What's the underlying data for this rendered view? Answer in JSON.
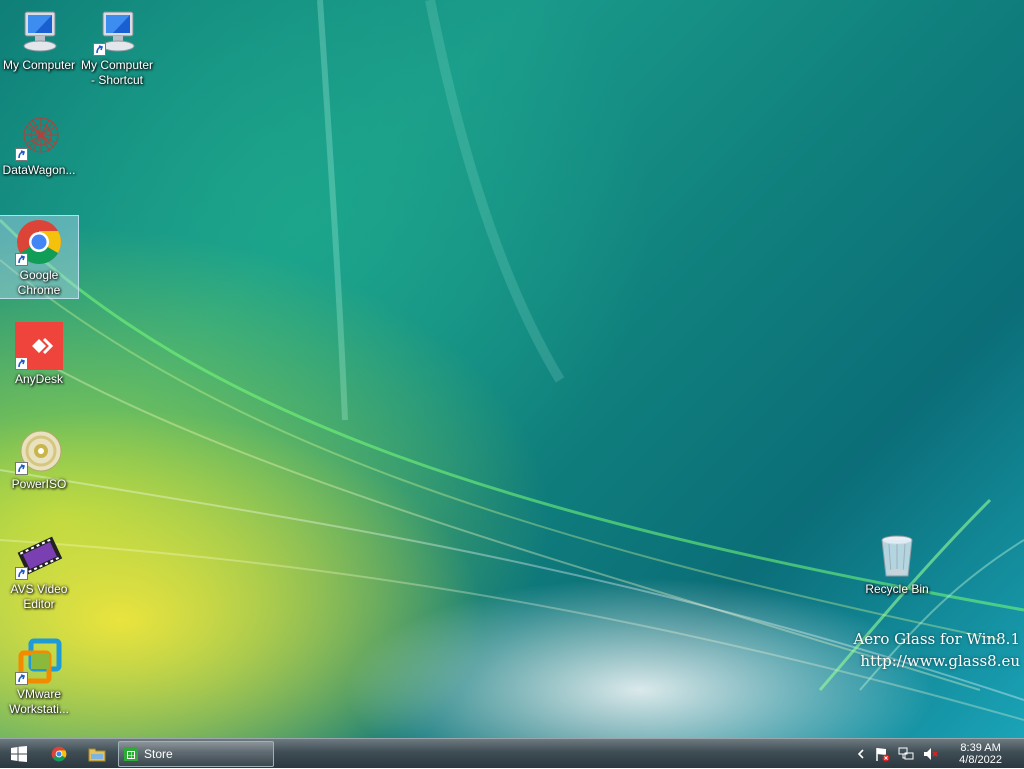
{
  "desktop_icons": [
    {
      "label": "My Computer",
      "icon": "computer-icon",
      "shortcut": false
    },
    {
      "label": "My Computer - Shortcut",
      "icon": "computer-icon",
      "shortcut": true
    },
    {
      "label": "DataWagon...",
      "icon": "datawagon-icon",
      "shortcut": true
    },
    {
      "label": "Google Chrome",
      "icon": "chrome-icon",
      "shortcut": true,
      "selected": true
    },
    {
      "label": "AnyDesk",
      "icon": "anydesk-icon",
      "shortcut": true
    },
    {
      "label": "PowerISO",
      "icon": "poweriso-icon",
      "shortcut": true
    },
    {
      "label": "AVS Video Editor",
      "icon": "avs-video-editor-icon",
      "shortcut": true
    },
    {
      "label": "VMware Workstati...",
      "icon": "vmware-icon",
      "shortcut": true
    },
    {
      "label": "Recycle Bin",
      "icon": "recycle-bin-icon",
      "shortcut": false
    }
  ],
  "watermark": {
    "line1": "Aero Glass for Win8.1",
    "line2": "http://www.glass8.eu"
  },
  "taskbar": {
    "start_icon": "windows-logo-icon",
    "pinned": [
      "chrome-icon",
      "file-explorer-icon"
    ],
    "running_task": {
      "label": "Store",
      "icon": "store-icon"
    },
    "tray_icons": [
      "chevron-left-icon",
      "action-center-flag-icon",
      "network-icon",
      "volume-muted-icon"
    ],
    "clock_time": "8:39 AM",
    "clock_date": "4/8/2022"
  },
  "colors": {
    "anydesk_red": "#ef443b",
    "chrome_red": "#db4437",
    "chrome_yellow": "#f4c20d",
    "chrome_green": "#0f9d58",
    "chrome_blue": "#4285f4",
    "vmware_blue": "#1d9bd7",
    "vmware_orange": "#f38b00"
  }
}
